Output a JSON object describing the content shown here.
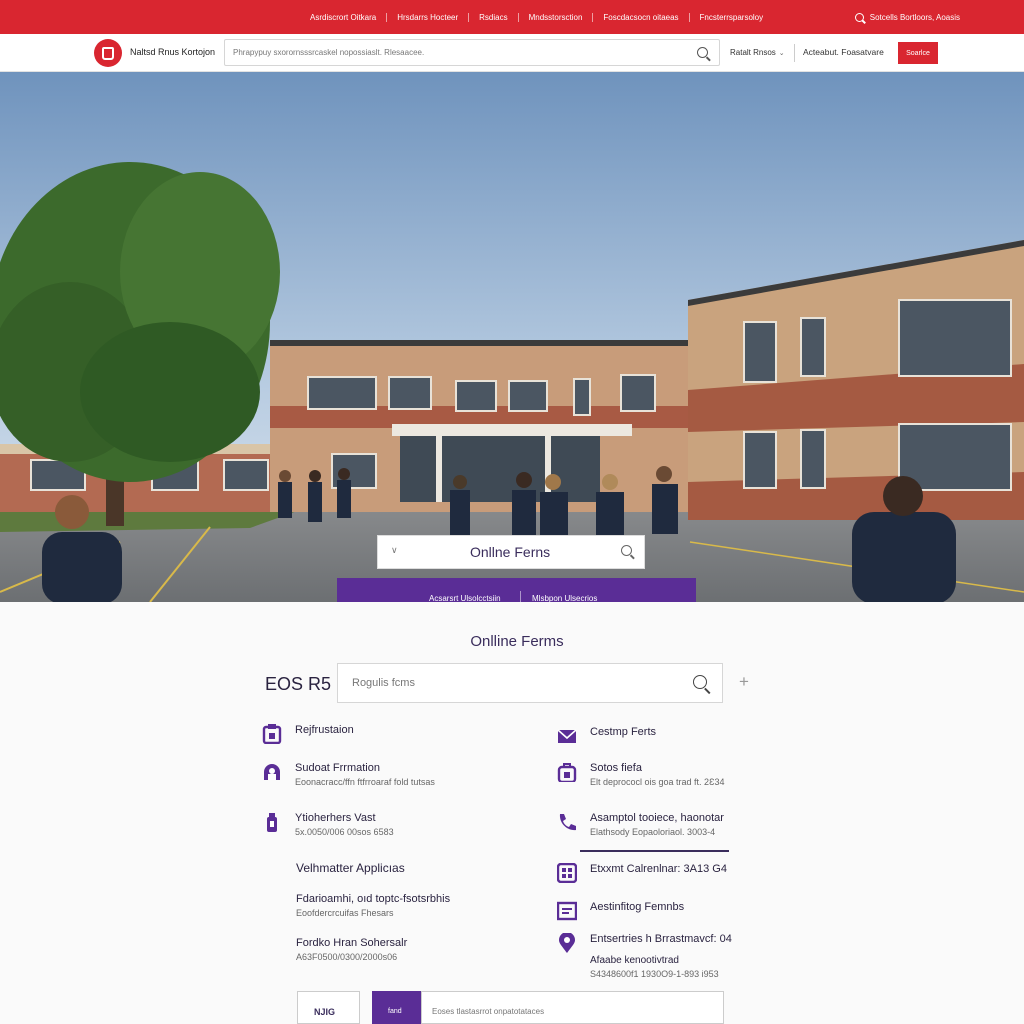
{
  "top_nav": {
    "links": [
      "Asrdiscrort Oitkara",
      "Hrsdarrs Hocteer",
      "Rsdiacs",
      "Mndsstorsction",
      "Foscdacsocn oitaeas",
      "Fncsterrsparsoloy"
    ],
    "account_label": "Sotcells Bortloors, Aoasis"
  },
  "header": {
    "site_name": "Naltsd Rnus Kortojon",
    "search_placeholder": "Phrapypuy sxorornsssrcaskel nopossiaslt. Rlesaacee.",
    "link1": "Ratalt Rnsos",
    "link2": "Acteabut. Foasatvare",
    "button": "Soarlce",
    "link1_chevron": "⌄"
  },
  "hero": {
    "search_text": "Onllne Ferns",
    "tab1": "Acsarsrt Ulsolcctsiin",
    "tab2": "Mlsbpon Ulsecrios"
  },
  "forms": {
    "title": "Onlline Ferms",
    "label": "EOS R5",
    "search_placeholder": "Rogulis fcms",
    "plus": "+",
    "left_items": [
      {
        "title": "Rejfrustaion",
        "sub": "",
        "icon": "clipboard-icon"
      },
      {
        "title": "Sudoat  Frrmation",
        "sub": "Eoonacracc/ffn ftfrroaraf fold tutsas",
        "icon": "student-icon"
      },
      {
        "title": "Ytioherhers Vast",
        "sub": "5x.0050/006 00sos  6583",
        "icon": "bottle-icon"
      },
      {
        "title": "Velhmatter Applicıas",
        "sub": "",
        "icon": ""
      },
      {
        "title": "Fdarioamhi, oıd toptc-fsotsrbhis",
        "sub": "Eoofdercrcuifas  Fhesars",
        "icon": ""
      },
      {
        "title": "Fordko  Hran  Sohersalr",
        "sub": "A63F0500/0300/2000s06",
        "icon": ""
      }
    ],
    "right_items": [
      {
        "title": "Cestmp Ferts",
        "sub": "",
        "icon": "envelope-icon"
      },
      {
        "title": "Sotos fiefa",
        "sub": "Elt deprococl  ois goa trad ft. 2Ɛ34",
        "icon": "backpack-icon"
      },
      {
        "title": "Asamptol tooiece, haonotar",
        "sub": "Elathsody Eopaoloriaol. 3003-4",
        "icon": "phone-icon"
      },
      {
        "title": "Etxxmt  Calrenlnar: 3A13 G4",
        "sub": "",
        "icon": "calendar-icon"
      },
      {
        "title": "Aestinfitog Femnbs",
        "sub": "",
        "icon": "form-icon"
      },
      {
        "title": "Entsertries h Brrastmavcf: 04",
        "sub": "Afaabe  kenootivtrad",
        "sub2": "S4348600f1 1930O9-1-893 i953",
        "icon": "location-pin-icon"
      }
    ]
  },
  "bottom": {
    "box_label": "NJIG",
    "button_label": "fand",
    "field_text": "Eoses tlastasrrot onpatotataces"
  },
  "colors": {
    "brand_red": "#d92630",
    "brand_purple": "#5a2d96",
    "text_dark": "#2a2340"
  }
}
